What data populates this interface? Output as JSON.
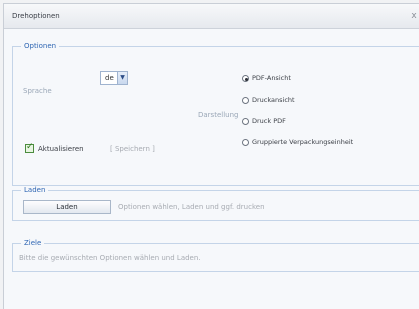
{
  "window": {
    "title": "Drehoptionen",
    "close_glyph": "x"
  },
  "options": {
    "legend": "Optionen",
    "language_label": "Sprache",
    "language_value": "de",
    "display_label": "Darstellung",
    "radios": [
      {
        "label": "PDF-Ansicht",
        "checked": true
      },
      {
        "label": "Druckansicht",
        "checked": false
      },
      {
        "label": "Druck PDF",
        "checked": false
      },
      {
        "label": "Gruppierte Verpackungseinheit",
        "checked": false
      }
    ],
    "update_label": "Aktualisieren",
    "update_checked": true,
    "save_label": "[ Speichern ]"
  },
  "load": {
    "legend": "Laden",
    "button_label": "Laden",
    "hint": "Optionen wählen, Laden und ggf. drucken"
  },
  "goal": {
    "legend": "Ziele",
    "text": "Bitte die gewünschten Optionen wählen und Laden."
  },
  "colors": {
    "accent": "#2f66b3",
    "border": "#c4d4e8"
  },
  "icons": {
    "close": "close-icon",
    "dropdown": "chevron-down-icon"
  }
}
